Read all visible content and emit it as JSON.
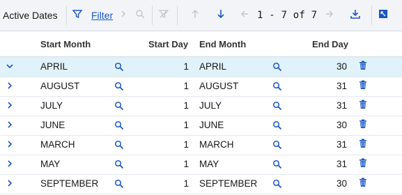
{
  "toolbar": {
    "title": "Active Dates",
    "filter_label": "Filter",
    "pager_text": "1 - 7 of 7"
  },
  "columns": {
    "start_month": "Start Month",
    "start_day": "Start Day",
    "end_month": "End Month",
    "end_day": "End Day"
  },
  "rows": [
    {
      "start_month": "APRIL",
      "start_day": "1",
      "end_month": "APRIL",
      "end_day": "30",
      "expanded": true
    },
    {
      "start_month": "AUGUST",
      "start_day": "1",
      "end_month": "AUGUST",
      "end_day": "31"
    },
    {
      "start_month": "JULY",
      "start_day": "1",
      "end_month": "JULY",
      "end_day": "31"
    },
    {
      "start_month": "JUNE",
      "start_day": "1",
      "end_month": "JUNE",
      "end_day": "30"
    },
    {
      "start_month": "MARCH",
      "start_day": "1",
      "end_month": "MARCH",
      "end_day": "31"
    },
    {
      "start_month": "MAY",
      "start_day": "1",
      "end_month": "MAY",
      "end_day": "31"
    },
    {
      "start_month": "SEPTEMBER",
      "start_day": "1",
      "end_month": "SEPTEMBER",
      "end_day": "30"
    }
  ],
  "colors": {
    "accent": "#1a56c4",
    "selected_row": "#e0f2fa",
    "toolbar_bg": "#f2f4f8"
  },
  "icons": {
    "filter": "filter-icon",
    "next": "chevron-right-icon",
    "search": "search-icon",
    "clear_filter": "clear-filter-icon",
    "sort_up": "arrow-up-icon",
    "sort_down": "arrow-down-icon",
    "prev_page": "arrow-left-icon",
    "next_page": "arrow-right-icon",
    "download": "download-icon",
    "maximize": "maximize-icon",
    "expand": "chevron-right-icon",
    "collapse": "chevron-down-icon",
    "delete": "trash-icon"
  }
}
